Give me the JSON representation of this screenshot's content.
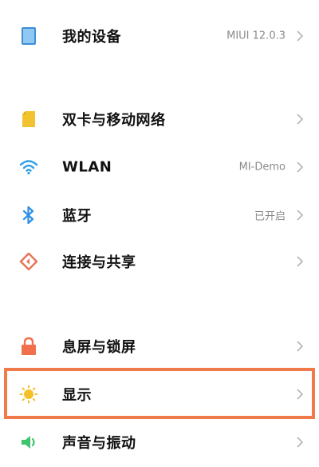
{
  "settings": {
    "items": [
      {
        "label": "我的设备",
        "value": "MIUI 12.0.3",
        "icon": "device-icon",
        "color": "#5aa7e8"
      },
      {
        "label": "双卡与移动网络",
        "value": "",
        "icon": "sim-card-icon",
        "color": "#f2c230"
      },
      {
        "label": "WLAN",
        "value": "MI-Demo",
        "icon": "wifi-icon",
        "color": "#2f9ee6"
      },
      {
        "label": "蓝牙",
        "value": "已开启",
        "icon": "bluetooth-icon",
        "color": "#2f8fe6"
      },
      {
        "label": "连接与共享",
        "value": "",
        "icon": "connection-share-icon",
        "color": "#e8785a"
      },
      {
        "label": "息屏与锁屏",
        "value": "",
        "icon": "lock-icon",
        "color": "#f0704e"
      },
      {
        "label": "显示",
        "value": "",
        "icon": "sun-icon",
        "color": "#f5c02a"
      },
      {
        "label": "声音与振动",
        "value": "",
        "icon": "speaker-icon",
        "color": "#3ec46d"
      }
    ]
  },
  "highlight_color": "#f07a4a"
}
